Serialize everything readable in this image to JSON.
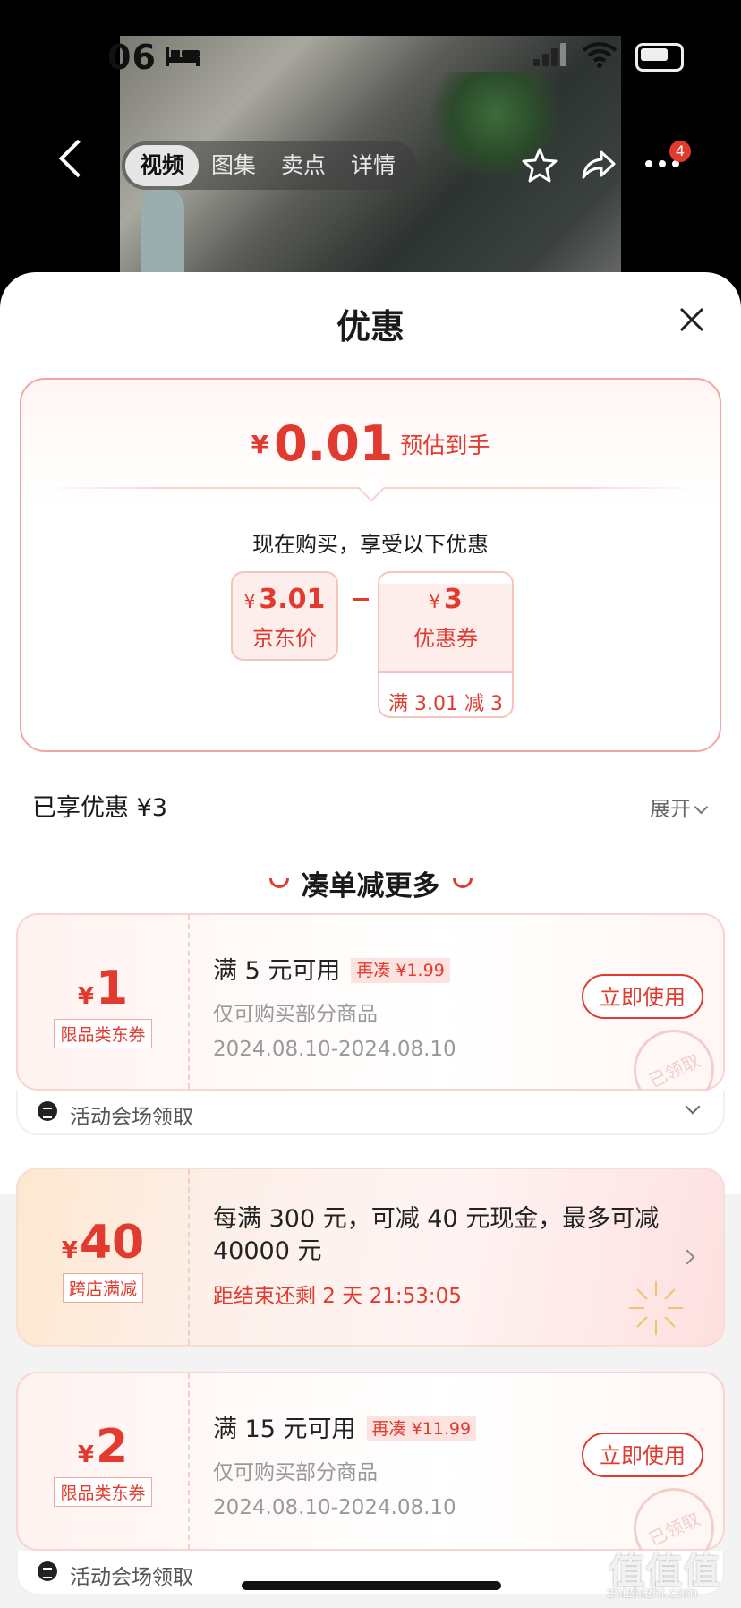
{
  "status": {
    "time": "06"
  },
  "nav": {
    "tabs": [
      "视频",
      "图集",
      "卖点",
      "详情"
    ],
    "active_tab": "视频",
    "more_badge": "4"
  },
  "sheet": {
    "title": "优惠",
    "summary": {
      "currency": "¥",
      "final_price": "0.01",
      "final_label": "预估到手",
      "enjoy_text": "现在购买，享受以下优惠",
      "jd_price_value": "3.01",
      "jd_price_label": "京东价",
      "coupon_value": "3",
      "coupon_label": "优惠券",
      "coupon_condition": "满 3.01 减 3"
    },
    "enjoyed": "已享优惠 ¥3",
    "expand_label": "展开",
    "section_title": "凑单减更多",
    "coupons": [
      {
        "currency": "¥",
        "value": "1",
        "kind": "限品类东券",
        "condition": "满 5 元可用",
        "need_more": "再凑 ¥1.99",
        "scope": "仅可购买部分商品",
        "validity": "2024.08.10-2024.08.10",
        "button": "立即使用",
        "stamp": "已领取",
        "source": "活动会场领取"
      },
      {
        "currency": "¥",
        "value": "40",
        "kind": "跨店满减",
        "description": "每满 300 元，可减 40 元现金，最多可减 40000 元",
        "countdown": "距结束还剩 2 天 21:53:05"
      },
      {
        "currency": "¥",
        "value": "2",
        "kind": "限品类东券",
        "condition": "满 15 元可用",
        "need_more": "再凑 ¥11.99",
        "scope": "仅可购买部分商品",
        "validity": "2024.08.10-2024.08.10",
        "button": "立即使用",
        "stamp": "已领取",
        "source": "活动会场领取"
      }
    ]
  },
  "watermark": {
    "text": "值值值",
    "url": "zhizhizhi.com"
  },
  "colors": {
    "accent": "#e23a2e",
    "border": "#f1a79f"
  }
}
